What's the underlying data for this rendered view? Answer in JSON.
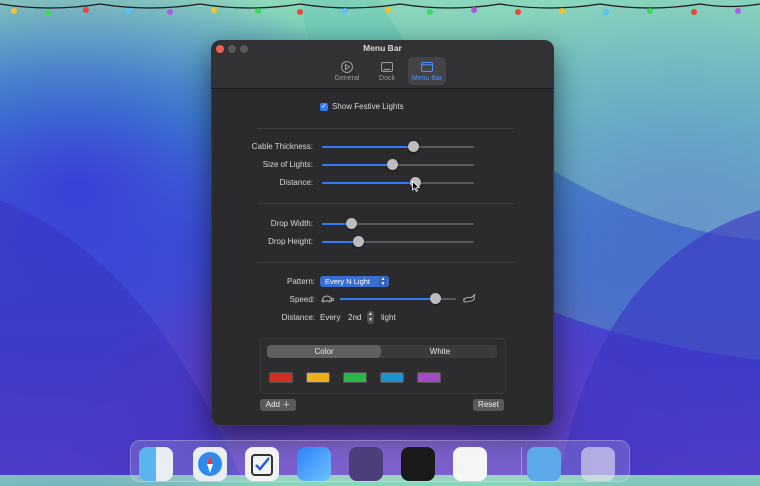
{
  "window": {
    "title": "Menu Bar",
    "tabs": [
      {
        "label": "General",
        "icon": "general-icon"
      },
      {
        "label": "Dock",
        "icon": "dock-icon"
      },
      {
        "label": "Menu Bar",
        "icon": "menubar-icon",
        "active": true
      }
    ]
  },
  "festive": {
    "label": "Show Festive Lights",
    "checked": true
  },
  "sliders_group1": [
    {
      "label": "Cable Thickness:",
      "value": 0.6
    },
    {
      "label": "Size of Lights:",
      "value": 0.46
    },
    {
      "label": "Distance:",
      "value": 0.61
    }
  ],
  "sliders_group2": [
    {
      "label": "Drop Width:",
      "value": 0.19
    },
    {
      "label": "Drop Height:",
      "value": 0.24
    }
  ],
  "pattern": {
    "label": "Pattern:",
    "value": "Every N Light"
  },
  "speed": {
    "label": "Speed:",
    "value": 0.82,
    "slow_icon": "turtle-icon",
    "fast_icon": "hare-icon"
  },
  "distance_n": {
    "label": "Distance:",
    "prefix": "Every",
    "value": "2nd",
    "suffix": "light"
  },
  "color_mode": {
    "options": [
      "Color",
      "White"
    ],
    "selected": "Color"
  },
  "swatches": [
    "#d22e22",
    "#f0ad1c",
    "#2bb64a",
    "#1e92cf",
    "#a34bc4"
  ],
  "buttons": {
    "add": "Add",
    "reset": "Reset"
  },
  "colors": {
    "accent": "#2f7cf6",
    "window_bg": "#2b2b2d"
  }
}
